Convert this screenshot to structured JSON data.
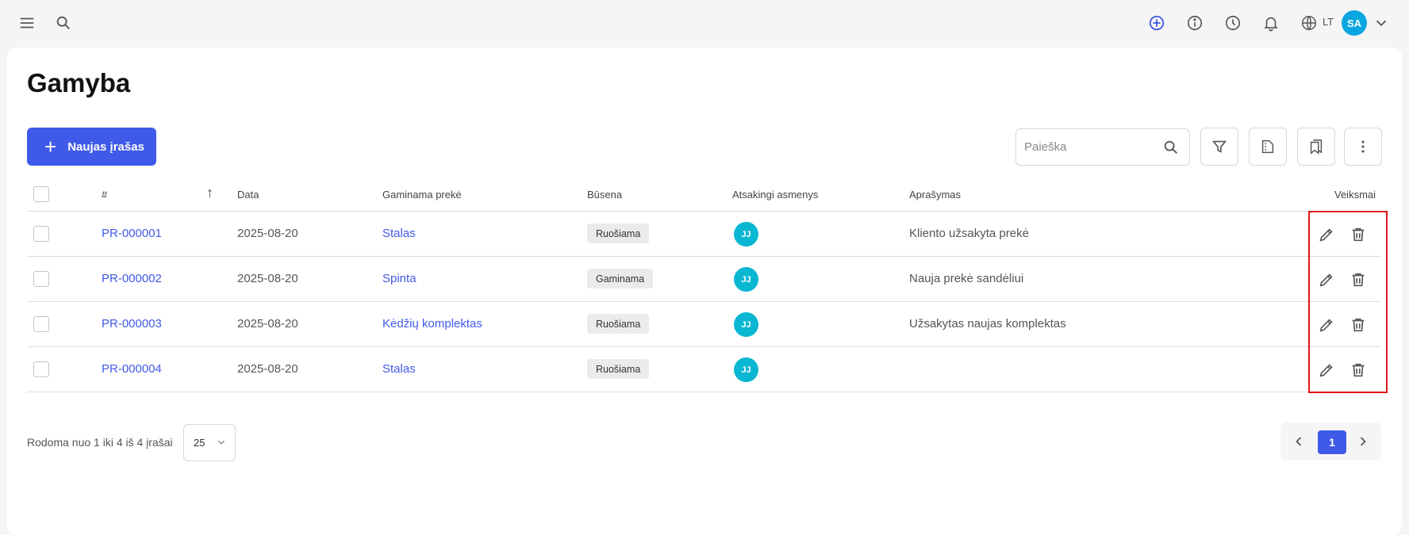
{
  "app": {
    "language": "LT",
    "user_initials": "SA"
  },
  "page": {
    "title": "Gamyba",
    "new_button_label": "Naujas įrašas",
    "search_placeholder": "Paieška"
  },
  "table": {
    "columns": [
      "#",
      "Data",
      "Gaminama prekė",
      "Būsena",
      "Atsakingi asmenys",
      "Aprašymas",
      "Veiksmai"
    ],
    "sort": {
      "column": "#",
      "direction": "ascending"
    },
    "rows": [
      {
        "id": "PR-000001",
        "date": "2025-08-20",
        "product": "Stalas",
        "status": "Ruošiama",
        "person": "JJ",
        "description": "Kliento užsakyta prekė"
      },
      {
        "id": "PR-000002",
        "date": "2025-08-20",
        "product": "Spinta",
        "status": "Gaminama",
        "person": "JJ",
        "description": "Nauja prekė sandėliui"
      },
      {
        "id": "PR-000003",
        "date": "2025-08-20",
        "product": "Kėdžių komplektas",
        "status": "Ruošiama",
        "person": "JJ",
        "description": "Užsakytas naujas komplektas"
      },
      {
        "id": "PR-000004",
        "date": "2025-08-20",
        "product": "Stalas",
        "status": "Ruošiama",
        "person": "JJ",
        "description": ""
      }
    ]
  },
  "footer": {
    "summary": "Rodoma nuo 1 iki 4 iš 4 įrašai",
    "page_size": "25",
    "current_page": "1"
  },
  "colors": {
    "primary": "#3f5ae8",
    "avatar_user": "#0aa6e0",
    "avatar_person": "#09b7d2",
    "highlight": "#e0151b"
  }
}
